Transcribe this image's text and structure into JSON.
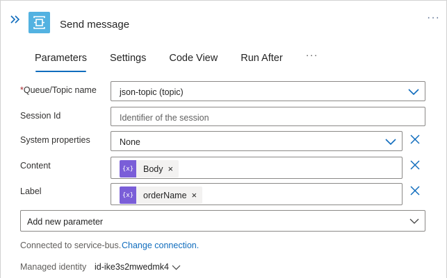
{
  "header": {
    "title": "Send message",
    "more_label": "···"
  },
  "tabs": [
    {
      "label": "Parameters",
      "active": true
    },
    {
      "label": "Settings",
      "active": false
    },
    {
      "label": "Code View",
      "active": false
    },
    {
      "label": "Run After",
      "active": false
    }
  ],
  "tabs_more_label": "···",
  "fields": {
    "queue_topic": {
      "label": "Queue/Topic name",
      "required_marker": "*",
      "value": "json-topic (topic)"
    },
    "session_id": {
      "label": "Session Id",
      "placeholder": "Identifier of the session"
    },
    "system_properties": {
      "label": "System properties",
      "value": "None"
    },
    "content": {
      "label": "Content",
      "token": "Body",
      "token_icon": "{x}"
    },
    "label": {
      "label": "Label",
      "token": "orderName",
      "token_icon": "{x}"
    }
  },
  "add_parameter": {
    "label": "Add new parameter"
  },
  "connection": {
    "text": "Connected to service-bus.",
    "link": "Change connection."
  },
  "managed_identity": {
    "label": "Managed identity",
    "value": "id-ike3s2mwedmk4"
  },
  "colors": {
    "accent": "#0f6cbd",
    "action_icon": "#53b2e1",
    "token_icon": "#7a5ed8",
    "required": "#a4262c"
  }
}
